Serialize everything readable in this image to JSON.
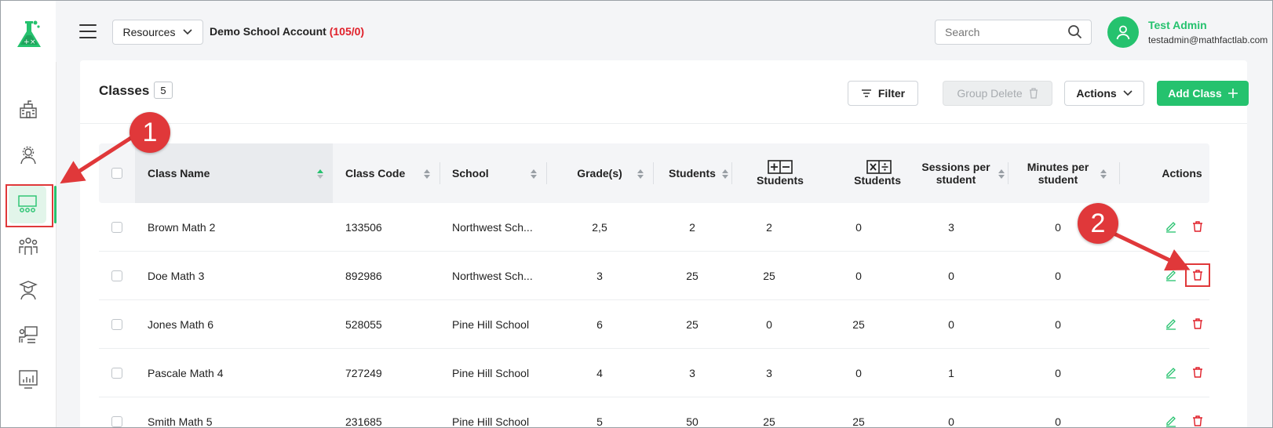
{
  "header": {
    "resources_label": "Resources",
    "account_name": "Demo School Account",
    "account_count": "(105/0)",
    "search_placeholder": "Search",
    "user_name": "Test Admin",
    "user_email": "testadmin@mathfactlab.com"
  },
  "sidebar": {
    "items": [
      {
        "icon": "school-icon"
      },
      {
        "icon": "admin-gear-icon"
      },
      {
        "icon": "classroom-icon",
        "active": true
      },
      {
        "icon": "students-group-icon"
      },
      {
        "icon": "graduate-icon"
      },
      {
        "icon": "teacher-board-icon"
      },
      {
        "icon": "reports-chart-icon"
      }
    ]
  },
  "page": {
    "title": "Classes",
    "count": "5",
    "filter_label": "Filter",
    "group_delete_label": "Group Delete",
    "actions_label": "Actions",
    "add_class_label": "Add Class"
  },
  "table": {
    "headers": {
      "class_name": "Class Name",
      "class_code": "Class Code",
      "school": "School",
      "grades": "Grade(s)",
      "students": "Students",
      "addsub_students": "Students",
      "muldiv_students": "Students",
      "sessions_1": "Sessions per",
      "sessions_2": "student",
      "minutes_1": "Minutes per",
      "minutes_2": "student",
      "actions": "Actions"
    },
    "rows": [
      {
        "name": "Brown Math 2",
        "code": "133506",
        "school": "Northwest Sch...",
        "grades": "2,5",
        "students": "2",
        "addsub": "2",
        "muldiv": "0",
        "sessions": "3",
        "minutes": "0"
      },
      {
        "name": "Doe Math 3",
        "code": "892986",
        "school": "Northwest Sch...",
        "grades": "3",
        "students": "25",
        "addsub": "25",
        "muldiv": "0",
        "sessions": "0",
        "minutes": "0"
      },
      {
        "name": "Jones Math 6",
        "code": "528055",
        "school": "Pine Hill School",
        "grades": "6",
        "students": "25",
        "addsub": "0",
        "muldiv": "25",
        "sessions": "0",
        "minutes": "0"
      },
      {
        "name": "Pascale Math 4",
        "code": "727249",
        "school": "Pine Hill School",
        "grades": "4",
        "students": "3",
        "addsub": "3",
        "muldiv": "0",
        "sessions": "1",
        "minutes": "0"
      },
      {
        "name": "Smith Math 5",
        "code": "231685",
        "school": "Pine Hill School",
        "grades": "5",
        "students": "50",
        "addsub": "25",
        "muldiv": "25",
        "sessions": "0",
        "minutes": "0"
      }
    ]
  },
  "annotations": {
    "callout_1": "1",
    "callout_2": "2",
    "color": "#e0383a"
  },
  "colors": {
    "brand_green": "#25c26e",
    "danger_red": "#e0202a"
  }
}
